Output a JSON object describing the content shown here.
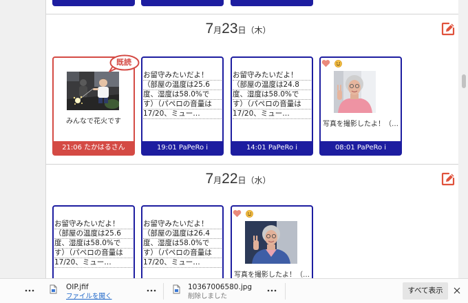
{
  "colors": {
    "red": "#d44a44",
    "navy": "#1d1da0",
    "edit": "#e0523c",
    "link": "#1a64c8",
    "heart": "#ea8a7c"
  },
  "sections": [
    {
      "date": {
        "month": "7",
        "month_unit": "月",
        "day": "23",
        "day_unit": "日",
        "weekday": "（木）"
      },
      "cards": [
        {
          "badge": "既読",
          "caption": "みんなで花火です",
          "footer": "21:06 たかはるさん"
        },
        {
          "lines": [
            "お留守みたいだよ！",
            "（部屋の温度は25.6",
            "度、湿度は58.0%で",
            "す）（パペロの音量は",
            "17/20、ミュー…"
          ],
          "footer": "19:01 PaPeRo i"
        },
        {
          "lines": [
            "お留守みたいだよ！",
            "（部屋の温度は24.8",
            "度、湿度は58.0%で",
            "す）（パペロの音量は",
            "17/20、ミュー…"
          ],
          "footer": "14:01 PaPeRo i"
        },
        {
          "reactions": [
            "heart-icon",
            "smile-icon"
          ],
          "caption": "写真を撮影したよ！（…",
          "footer": "08:01 PaPeRo i"
        }
      ]
    },
    {
      "date": {
        "month": "7",
        "month_unit": "月",
        "day": "22",
        "day_unit": "日",
        "weekday": "（水）"
      },
      "cards": [
        {
          "lines": [
            "お留守みたいだよ！",
            "（部屋の温度は25.6",
            "度、湿度は58.0%で",
            "す）（パペロの音量は",
            "17/20、ミュー…"
          ]
        },
        {
          "lines": [
            "お留守みたいだよ！",
            "（部屋の温度は26.4",
            "度、湿度は58.0%で",
            "す）（パペロの音量は",
            "17/20、ミュー…"
          ]
        },
        {
          "reactions": [
            "heart-icon",
            "smile-icon"
          ],
          "caption": "写真を撮影したよ！（…"
        }
      ]
    }
  ],
  "downloads": [
    {
      "filename": "OIP.jfif",
      "status": "ファイルを開く"
    },
    {
      "filename": "10367006580.jpg",
      "status": "削除しました"
    }
  ],
  "download_bar": {
    "show_all": "すべて表示"
  }
}
